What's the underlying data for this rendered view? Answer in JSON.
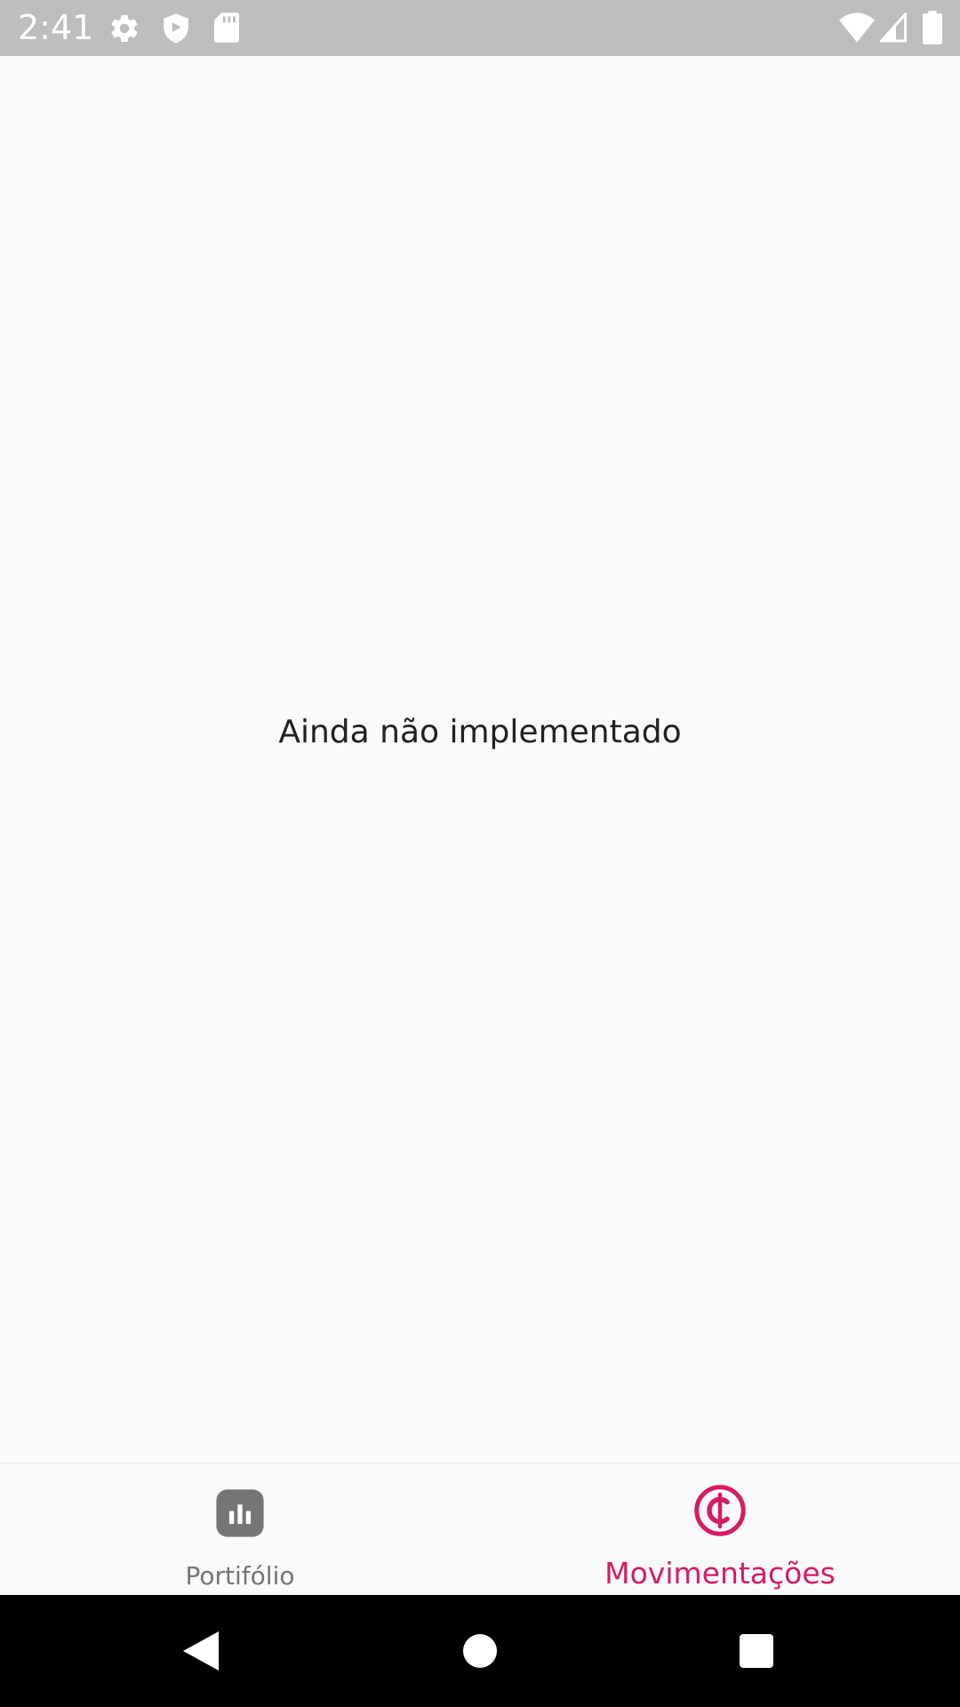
{
  "status_bar": {
    "time": "2:41",
    "icons": [
      "settings-icon",
      "shield-icon",
      "sd-card-icon",
      "wifi-icon",
      "cell-signal-icon",
      "battery-icon"
    ]
  },
  "main": {
    "message": "Ainda não implementado"
  },
  "bottom_nav": {
    "items": [
      {
        "label": "Portifólio",
        "icon": "bar-chart-icon",
        "active": false
      },
      {
        "label": "Movimentações",
        "icon": "currency-cedi-icon",
        "active": true
      }
    ],
    "active_color": "#d81b60",
    "inactive_color": "#757575"
  },
  "system_nav": {
    "buttons": [
      "back-icon",
      "home-icon",
      "recents-icon"
    ]
  }
}
